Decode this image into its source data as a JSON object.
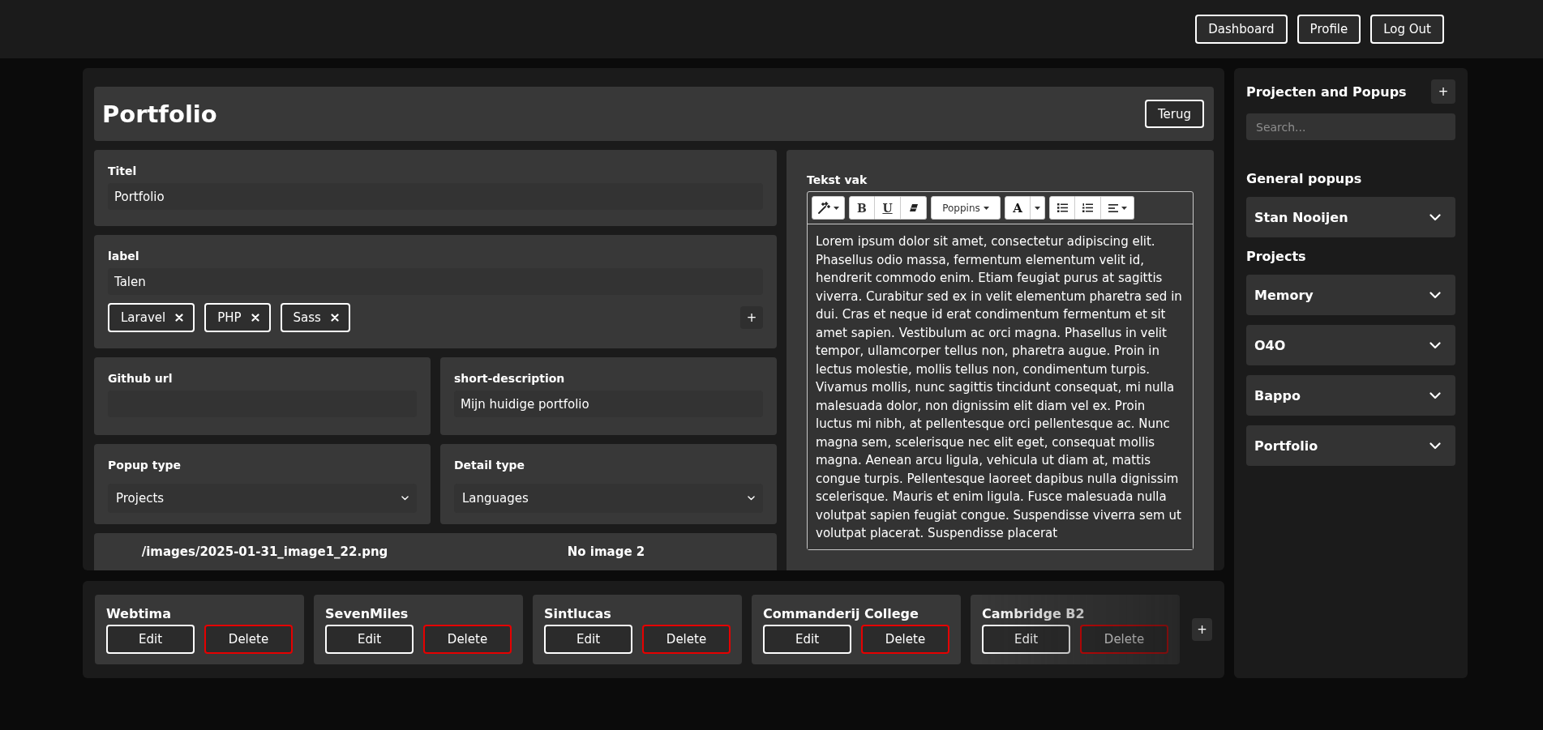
{
  "nav": {
    "buttons": [
      "Dashboard",
      "Profile",
      "Log Out"
    ]
  },
  "page_header": {
    "title": "Portfolio",
    "back_button": "Terug"
  },
  "title_field": {
    "label": "Titel",
    "value": "Portfolio"
  },
  "label_field": {
    "label": "label",
    "value": "Talen",
    "tags": [
      "Laravel",
      "PHP",
      "Sass"
    ],
    "add_button": "+"
  },
  "github_field": {
    "label": "Github url"
  },
  "short_description": {
    "label": "short-description",
    "value": "Mijn huidige portfolio"
  },
  "popup_type": {
    "label": "Popup type",
    "value": "Projects"
  },
  "detail_type": {
    "label": "Detail type",
    "value": "Languages"
  },
  "images": [
    "/images/2025-01-31_image1_22.png",
    "No image 2"
  ],
  "text_editor": {
    "label": "Tekst vak",
    "toolbar": [
      [
        {
          "kind": "wand"
        }
      ],
      [
        {
          "kind": "bold",
          "label": "B"
        },
        {
          "kind": "underline",
          "label": "U"
        },
        {
          "kind": "eraser"
        }
      ],
      [
        {
          "kind": "font",
          "label": "Poppins"
        }
      ],
      [
        {
          "kind": "highlight",
          "label": "A"
        },
        {
          "kind": "caret"
        }
      ],
      [
        {
          "kind": "bullets"
        },
        {
          "kind": "numbers"
        },
        {
          "kind": "align"
        }
      ]
    ],
    "content": "Lorem ipsum dolor sit amet, consectetur adipiscing elit. Phasellus odio massa, fermentum elementum velit id, hendrerit commodo enim. Etiam feugiat purus at sagittis viverra. Curabitur sed ex in velit elementum pharetra sed in dui. Cras et neque id erat condimentum fermentum et sit amet sapien. Vestibulum ac orci magna. Phasellus in velit tempor, ullamcorper tellus non, pharetra augue. Proin in lectus molestie, mollis tellus non, condimentum turpis. Vivamus mollis, nunc sagittis tincidunt consequat, mi nulla malesuada dolor, non dignissim elit diam vel ex. Proin luctus mi nibh, at pellentesque orci pellentesque ac. Nunc magna sem, scelerisque nec elit eget, consequat mollis magna. Aenean arcu ligula, vehicula ut diam at, mattis congue turpis. Pellentesque laoreet dapibus nulla dignissim scelerisque. Mauris et enim ligula. Fusce malesuada nulla volutpat sapien feugiat congue. Suspendisse viverra sem ut volutpat placerat. Suspendisse placerat"
  },
  "cards": [
    {
      "title": "Webtima",
      "edit": "Edit",
      "delete": "Delete"
    },
    {
      "title": "SevenMiles",
      "edit": "Edit",
      "delete": "Delete"
    },
    {
      "title": "Sintlucas",
      "edit": "Edit",
      "delete": "Delete"
    },
    {
      "title": "Commanderij College",
      "edit": "Edit",
      "delete": "Delete"
    },
    {
      "title": "Cambridge B2",
      "edit": "Edit",
      "delete": "Delete"
    }
  ],
  "add_card_button": "+",
  "sidebar": {
    "title": "Projecten and Popups",
    "add_button": "+",
    "search_placeholder": "Search...",
    "sections": [
      {
        "heading": "General popups",
        "items": [
          {
            "label": "Stan Nooijen",
            "expanded": false
          }
        ]
      },
      {
        "heading": "Projects",
        "items": [
          {
            "label": "Memory",
            "expanded": false
          },
          {
            "label": "O4O",
            "expanded": false
          },
          {
            "label": "Bappo",
            "expanded": false
          },
          {
            "label": "Portfolio",
            "expanded": false
          }
        ]
      }
    ]
  }
}
